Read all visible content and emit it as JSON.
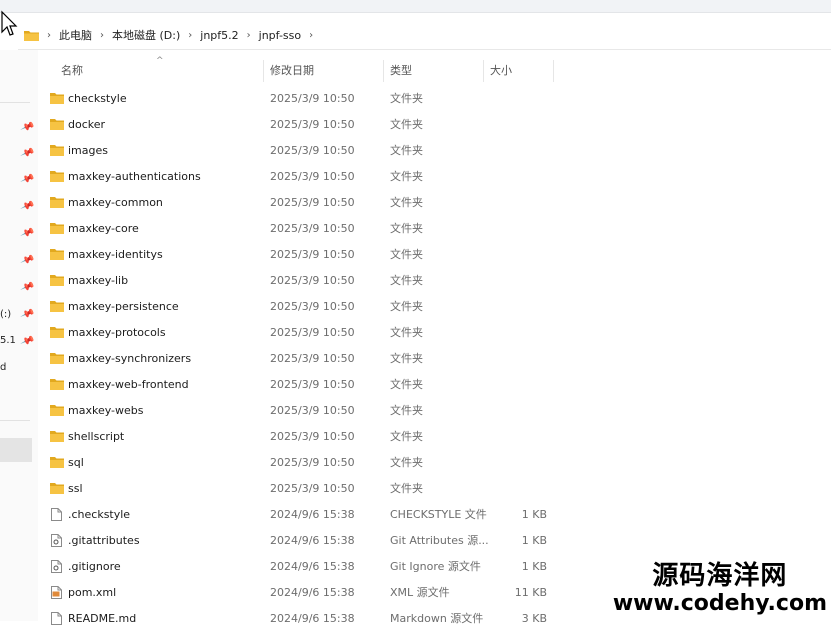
{
  "breadcrumb": [
    "此电脑",
    "本地磁盘 (D:)",
    "jnpf5.2",
    "jnpf-sso"
  ],
  "columns": {
    "name": "名称",
    "modified": "修改日期",
    "type": "类型",
    "size": "大小"
  },
  "files": [
    {
      "name": "checkstyle",
      "date": "2025/3/9 10:50",
      "type": "文件夹",
      "size": "",
      "icon": "folder-icon"
    },
    {
      "name": "docker",
      "date": "2025/3/9 10:50",
      "type": "文件夹",
      "size": "",
      "icon": "folder-icon"
    },
    {
      "name": "images",
      "date": "2025/3/9 10:50",
      "type": "文件夹",
      "size": "",
      "icon": "folder-icon"
    },
    {
      "name": "maxkey-authentications",
      "date": "2025/3/9 10:50",
      "type": "文件夹",
      "size": "",
      "icon": "folder-icon"
    },
    {
      "name": "maxkey-common",
      "date": "2025/3/9 10:50",
      "type": "文件夹",
      "size": "",
      "icon": "folder-icon"
    },
    {
      "name": "maxkey-core",
      "date": "2025/3/9 10:50",
      "type": "文件夹",
      "size": "",
      "icon": "folder-icon"
    },
    {
      "name": "maxkey-identitys",
      "date": "2025/3/9 10:50",
      "type": "文件夹",
      "size": "",
      "icon": "folder-icon"
    },
    {
      "name": "maxkey-lib",
      "date": "2025/3/9 10:50",
      "type": "文件夹",
      "size": "",
      "icon": "folder-icon"
    },
    {
      "name": "maxkey-persistence",
      "date": "2025/3/9 10:50",
      "type": "文件夹",
      "size": "",
      "icon": "folder-icon"
    },
    {
      "name": "maxkey-protocols",
      "date": "2025/3/9 10:50",
      "type": "文件夹",
      "size": "",
      "icon": "folder-icon"
    },
    {
      "name": "maxkey-synchronizers",
      "date": "2025/3/9 10:50",
      "type": "文件夹",
      "size": "",
      "icon": "folder-icon"
    },
    {
      "name": "maxkey-web-frontend",
      "date": "2025/3/9 10:50",
      "type": "文件夹",
      "size": "",
      "icon": "folder-icon"
    },
    {
      "name": "maxkey-webs",
      "date": "2025/3/9 10:50",
      "type": "文件夹",
      "size": "",
      "icon": "folder-icon"
    },
    {
      "name": "shellscript",
      "date": "2025/3/9 10:50",
      "type": "文件夹",
      "size": "",
      "icon": "folder-icon"
    },
    {
      "name": "sql",
      "date": "2025/3/9 10:50",
      "type": "文件夹",
      "size": "",
      "icon": "folder-icon"
    },
    {
      "name": "ssl",
      "date": "2025/3/9 10:50",
      "type": "文件夹",
      "size": "",
      "icon": "folder-icon"
    },
    {
      "name": ".checkstyle",
      "date": "2024/9/6 15:38",
      "type": "CHECKSTYLE 文件",
      "size": "1 KB",
      "icon": "file-icon"
    },
    {
      "name": ".gitattributes",
      "date": "2024/9/6 15:38",
      "type": "Git Attributes 源...",
      "size": "1 KB",
      "icon": "gear-file-icon"
    },
    {
      "name": ".gitignore",
      "date": "2024/9/6 15:38",
      "type": "Git Ignore 源文件",
      "size": "1 KB",
      "icon": "gear-file-icon"
    },
    {
      "name": "pom.xml",
      "date": "2024/9/6 15:38",
      "type": "XML 源文件",
      "size": "11 KB",
      "icon": "xml-file-icon"
    },
    {
      "name": "README.md",
      "date": "2024/9/6 15:38",
      "type": "Markdown 源文件",
      "size": "3 KB",
      "icon": "file-icon"
    }
  ],
  "sidebar_fragments": [
    "(:)",
    "5.1",
    "d"
  ],
  "watermark": {
    "line1": "源码海洋网",
    "line2": "www.codehy.com"
  },
  "colors": {
    "folder": "#f6c343",
    "folder_dark": "#e2a91f",
    "accent": "#0078d4"
  }
}
